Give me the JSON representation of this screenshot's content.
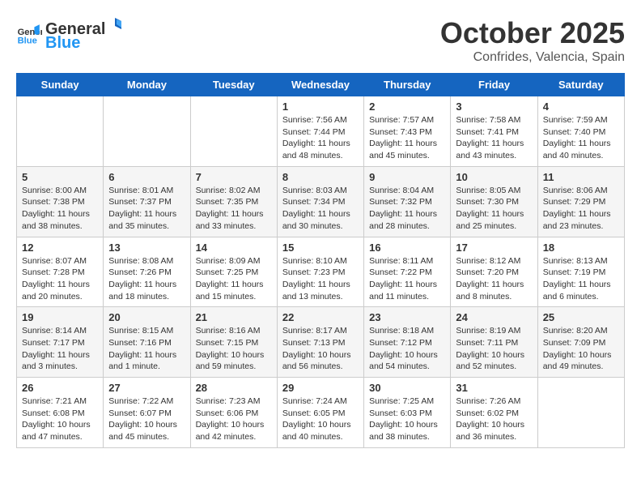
{
  "header": {
    "logo_general": "General",
    "logo_blue": "Blue",
    "month_year": "October 2025",
    "location": "Confrides, Valencia, Spain"
  },
  "weekdays": [
    "Sunday",
    "Monday",
    "Tuesday",
    "Wednesday",
    "Thursday",
    "Friday",
    "Saturday"
  ],
  "weeks": [
    [
      {
        "day": "",
        "info": ""
      },
      {
        "day": "",
        "info": ""
      },
      {
        "day": "",
        "info": ""
      },
      {
        "day": "1",
        "info": "Sunrise: 7:56 AM\nSunset: 7:44 PM\nDaylight: 11 hours and 48 minutes."
      },
      {
        "day": "2",
        "info": "Sunrise: 7:57 AM\nSunset: 7:43 PM\nDaylight: 11 hours and 45 minutes."
      },
      {
        "day": "3",
        "info": "Sunrise: 7:58 AM\nSunset: 7:41 PM\nDaylight: 11 hours and 43 minutes."
      },
      {
        "day": "4",
        "info": "Sunrise: 7:59 AM\nSunset: 7:40 PM\nDaylight: 11 hours and 40 minutes."
      }
    ],
    [
      {
        "day": "5",
        "info": "Sunrise: 8:00 AM\nSunset: 7:38 PM\nDaylight: 11 hours and 38 minutes."
      },
      {
        "day": "6",
        "info": "Sunrise: 8:01 AM\nSunset: 7:37 PM\nDaylight: 11 hours and 35 minutes."
      },
      {
        "day": "7",
        "info": "Sunrise: 8:02 AM\nSunset: 7:35 PM\nDaylight: 11 hours and 33 minutes."
      },
      {
        "day": "8",
        "info": "Sunrise: 8:03 AM\nSunset: 7:34 PM\nDaylight: 11 hours and 30 minutes."
      },
      {
        "day": "9",
        "info": "Sunrise: 8:04 AM\nSunset: 7:32 PM\nDaylight: 11 hours and 28 minutes."
      },
      {
        "day": "10",
        "info": "Sunrise: 8:05 AM\nSunset: 7:30 PM\nDaylight: 11 hours and 25 minutes."
      },
      {
        "day": "11",
        "info": "Sunrise: 8:06 AM\nSunset: 7:29 PM\nDaylight: 11 hours and 23 minutes."
      }
    ],
    [
      {
        "day": "12",
        "info": "Sunrise: 8:07 AM\nSunset: 7:28 PM\nDaylight: 11 hours and 20 minutes."
      },
      {
        "day": "13",
        "info": "Sunrise: 8:08 AM\nSunset: 7:26 PM\nDaylight: 11 hours and 18 minutes."
      },
      {
        "day": "14",
        "info": "Sunrise: 8:09 AM\nSunset: 7:25 PM\nDaylight: 11 hours and 15 minutes."
      },
      {
        "day": "15",
        "info": "Sunrise: 8:10 AM\nSunset: 7:23 PM\nDaylight: 11 hours and 13 minutes."
      },
      {
        "day": "16",
        "info": "Sunrise: 8:11 AM\nSunset: 7:22 PM\nDaylight: 11 hours and 11 minutes."
      },
      {
        "day": "17",
        "info": "Sunrise: 8:12 AM\nSunset: 7:20 PM\nDaylight: 11 hours and 8 minutes."
      },
      {
        "day": "18",
        "info": "Sunrise: 8:13 AM\nSunset: 7:19 PM\nDaylight: 11 hours and 6 minutes."
      }
    ],
    [
      {
        "day": "19",
        "info": "Sunrise: 8:14 AM\nSunset: 7:17 PM\nDaylight: 11 hours and 3 minutes."
      },
      {
        "day": "20",
        "info": "Sunrise: 8:15 AM\nSunset: 7:16 PM\nDaylight: 11 hours and 1 minute."
      },
      {
        "day": "21",
        "info": "Sunrise: 8:16 AM\nSunset: 7:15 PM\nDaylight: 10 hours and 59 minutes."
      },
      {
        "day": "22",
        "info": "Sunrise: 8:17 AM\nSunset: 7:13 PM\nDaylight: 10 hours and 56 minutes."
      },
      {
        "day": "23",
        "info": "Sunrise: 8:18 AM\nSunset: 7:12 PM\nDaylight: 10 hours and 54 minutes."
      },
      {
        "day": "24",
        "info": "Sunrise: 8:19 AM\nSunset: 7:11 PM\nDaylight: 10 hours and 52 minutes."
      },
      {
        "day": "25",
        "info": "Sunrise: 8:20 AM\nSunset: 7:09 PM\nDaylight: 10 hours and 49 minutes."
      }
    ],
    [
      {
        "day": "26",
        "info": "Sunrise: 7:21 AM\nSunset: 6:08 PM\nDaylight: 10 hours and 47 minutes."
      },
      {
        "day": "27",
        "info": "Sunrise: 7:22 AM\nSunset: 6:07 PM\nDaylight: 10 hours and 45 minutes."
      },
      {
        "day": "28",
        "info": "Sunrise: 7:23 AM\nSunset: 6:06 PM\nDaylight: 10 hours and 42 minutes."
      },
      {
        "day": "29",
        "info": "Sunrise: 7:24 AM\nSunset: 6:05 PM\nDaylight: 10 hours and 40 minutes."
      },
      {
        "day": "30",
        "info": "Sunrise: 7:25 AM\nSunset: 6:03 PM\nDaylight: 10 hours and 38 minutes."
      },
      {
        "day": "31",
        "info": "Sunrise: 7:26 AM\nSunset: 6:02 PM\nDaylight: 10 hours and 36 minutes."
      },
      {
        "day": "",
        "info": ""
      }
    ]
  ]
}
